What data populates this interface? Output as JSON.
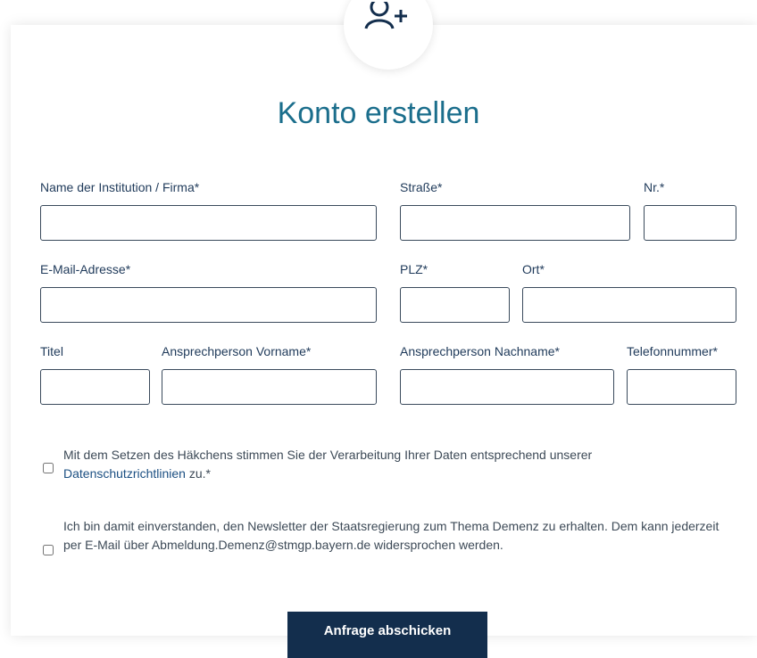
{
  "form": {
    "title": "Konto erstellen",
    "fields": {
      "institution": {
        "label": "Name der Institution / Firma*",
        "value": ""
      },
      "street": {
        "label": "Straße*",
        "value": ""
      },
      "number": {
        "label": "Nr.*",
        "value": ""
      },
      "email": {
        "label": "E-Mail-Adresse*",
        "value": ""
      },
      "plz": {
        "label": "PLZ*",
        "value": ""
      },
      "city": {
        "label": "Ort*",
        "value": ""
      },
      "salutation_title": {
        "label": "Titel",
        "value": ""
      },
      "first_name": {
        "label": "Ansprechperson Vorname*",
        "value": ""
      },
      "last_name": {
        "label": "Ansprechperson Nachname*",
        "value": ""
      },
      "phone": {
        "label": "Telefonnummer*",
        "value": ""
      }
    },
    "consent_privacy": {
      "text_before": "Mit dem Setzen des Häkchens stimmen Sie der Verarbeitung Ihrer Daten entsprechend unserer",
      "link_text": "Datenschutzrichtlinien",
      "text_after": " zu.*",
      "checked": false
    },
    "consent_newsletter": {
      "text": "Ich bin damit einverstanden, den Newsletter der Staatsregierung zum Thema Demenz zu erhalten. Dem kann jederzeit per E-Mail über Abmeldung.Demenz@stmgp.bayern.de widersprochen werden.",
      "checked": false
    },
    "submit_label": "Anfrage abschicken"
  },
  "icons": {
    "header": "add-user-icon"
  },
  "colors": {
    "title": "#1b6e8c",
    "button": "#132e4d",
    "label": "#1f3a5a"
  }
}
